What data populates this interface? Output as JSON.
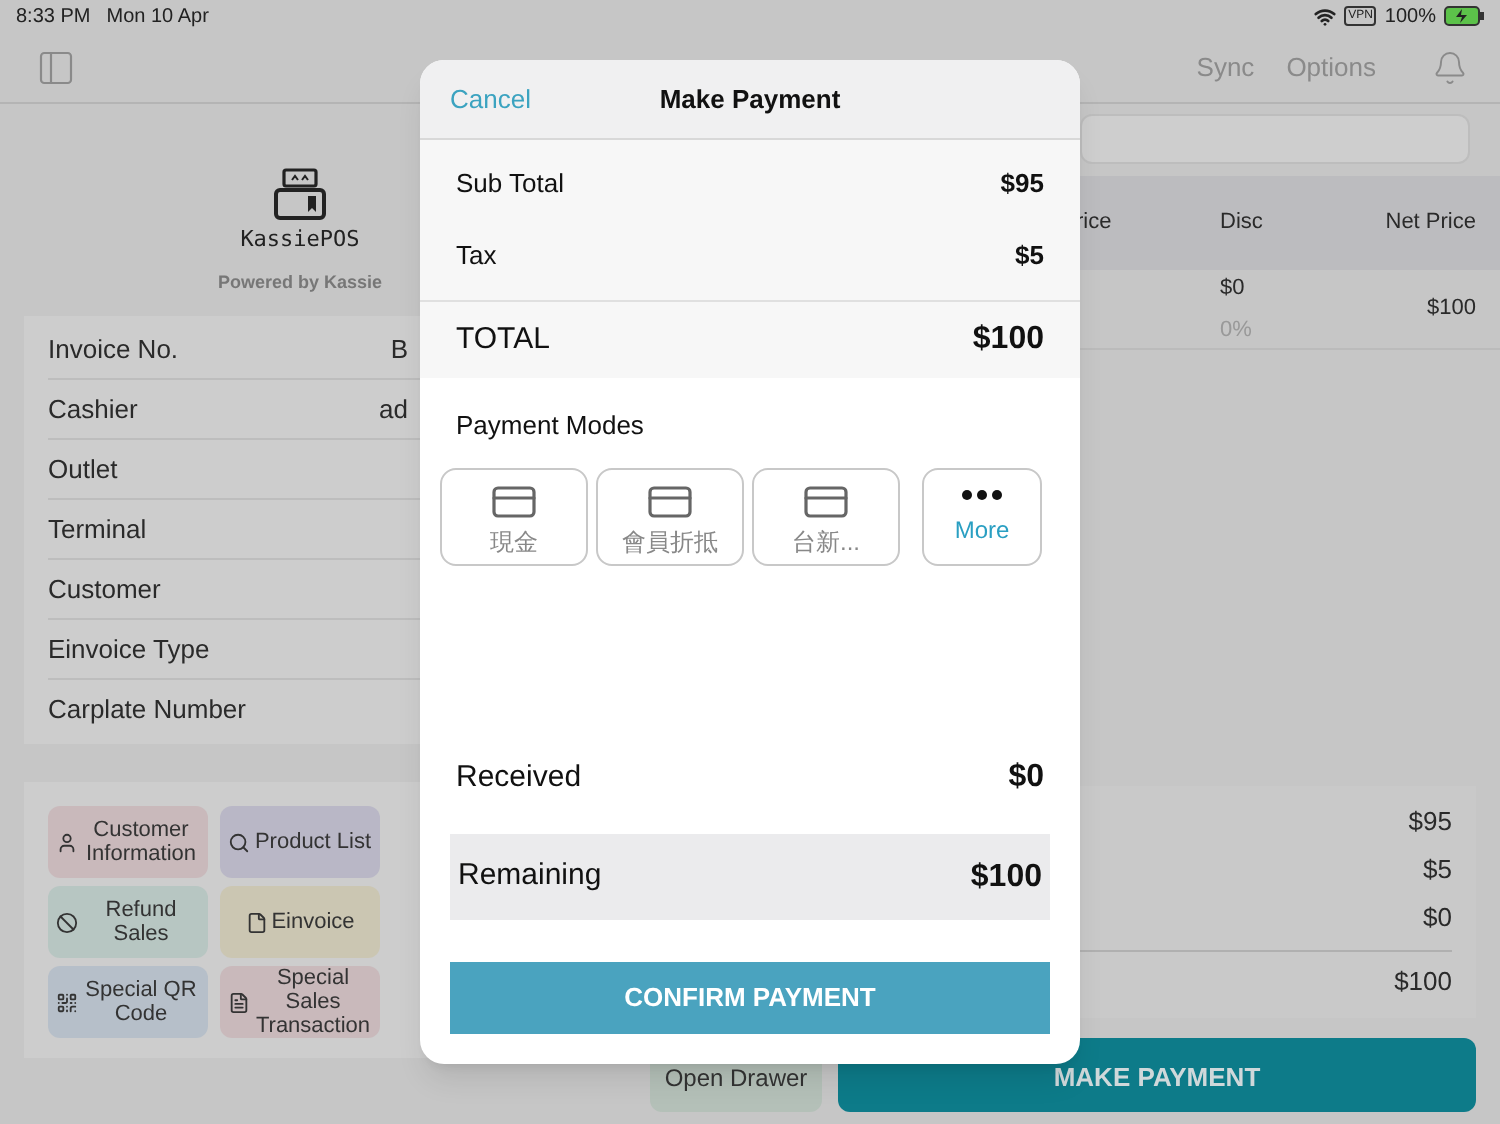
{
  "status_bar": {
    "time": "8:33 PM",
    "date": "Mon 10 Apr",
    "vpn": "VPN",
    "battery": "100%"
  },
  "nav": {
    "sync": "Sync",
    "options": "Options"
  },
  "brand": {
    "name": "KassiePOS",
    "tagline": "Powered by Kassie"
  },
  "info_rows": [
    {
      "label": "Invoice No.",
      "value": "B"
    },
    {
      "label": "Cashier",
      "value": "ad"
    },
    {
      "label": "Outlet"
    },
    {
      "label": "Terminal"
    },
    {
      "label": "Customer"
    },
    {
      "label": "Einvoice Type"
    },
    {
      "label": "Carplate Number"
    }
  ],
  "actions": [
    {
      "label": "Customer Information",
      "color": "#c9b9bb"
    },
    {
      "label": "Product List",
      "color": "#b9b7c6"
    },
    {
      "label": "Refund Sales",
      "color": "#b7c6c2"
    },
    {
      "label": "Einvoice",
      "color": "#cbc6b2"
    },
    {
      "label": "Special QR Code",
      "color": "#b6bfc9"
    },
    {
      "label": "Special Sales Transaction",
      "color": "#c9b9bb"
    }
  ],
  "table": {
    "columns": [
      "rice",
      "Disc",
      "Net Price"
    ],
    "rows": [
      {
        "disc": "$0",
        "disc_percent": "0%",
        "net_price": "$100"
      }
    ]
  },
  "summary": [
    "$95",
    "$5",
    "$0",
    "$100"
  ],
  "buttons": {
    "open_drawer": "Open Drawer",
    "make_payment": "MAKE PAYMENT"
  },
  "modal": {
    "cancel": "Cancel",
    "title": "Make Payment",
    "sub_total": {
      "label": "Sub Total",
      "value": "$95"
    },
    "tax": {
      "label": "Tax",
      "value": "$5"
    },
    "total": {
      "label": "TOTAL",
      "value": "$100"
    },
    "payment_modes_label": "Payment Modes",
    "modes": [
      {
        "kind": "card",
        "label": "現金"
      },
      {
        "kind": "card",
        "label": "會員折抵"
      },
      {
        "kind": "card",
        "label": "台新..."
      },
      {
        "kind": "more",
        "label": "More"
      }
    ],
    "received": {
      "label": "Received",
      "value": "$0"
    },
    "remaining": {
      "label": "Remaining",
      "value": "$100"
    },
    "confirm": "CONFIRM PAYMENT"
  }
}
